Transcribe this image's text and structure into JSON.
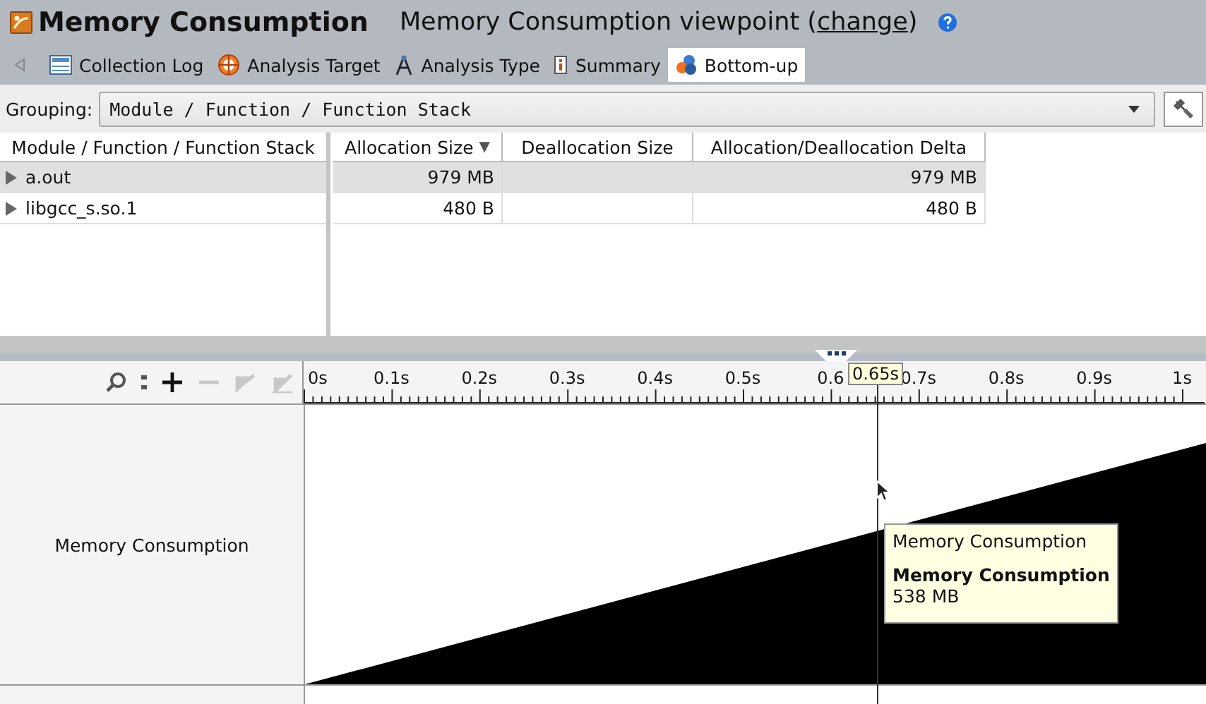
{
  "window": {
    "title": "Memory Consumption",
    "viewpoint_prefix": "Memory Consumption viewpoint (",
    "viewpoint_link": "change",
    "viewpoint_suffix": ")"
  },
  "tabs": [
    {
      "label": "Collection Log",
      "kind": "log",
      "selected": false
    },
    {
      "label": "Analysis Target",
      "kind": "target",
      "selected": false
    },
    {
      "label": "Analysis Type",
      "kind": "type",
      "selected": false
    },
    {
      "label": "Summary",
      "kind": "summary",
      "selected": false
    },
    {
      "label": "Bottom-up",
      "kind": "bottomup",
      "selected": true
    }
  ],
  "grouping": {
    "label": "Grouping:",
    "value": "Module / Function / Function Stack"
  },
  "table": {
    "tree_column": "Module / Function / Function Stack",
    "columns": [
      {
        "label": "Allocation Size",
        "sort_indicator": "▼"
      },
      {
        "label": "Deallocation Size"
      },
      {
        "label": "Allocation/Deallocation Delta"
      }
    ],
    "rows": [
      {
        "name": "a.out",
        "selected": true,
        "cells": [
          "979 MB",
          "",
          "979 MB"
        ]
      },
      {
        "name": "libgcc_s.so.1",
        "selected": false,
        "cells": [
          "480 B",
          "",
          "480 B"
        ]
      }
    ]
  },
  "timeline": {
    "tools": [
      {
        "kind": "zoom-in",
        "disabled": false
      },
      {
        "kind": "zoom-out",
        "disabled": true
      },
      {
        "kind": "undo",
        "disabled": true
      },
      {
        "kind": "reset",
        "disabled": true
      }
    ],
    "ticks": [
      "0s",
      "0.1s",
      "0.2s",
      "0.3s",
      "0.4s",
      "0.5s",
      "0.6",
      "0.7s",
      "0.8s",
      "0.9s",
      "1s"
    ],
    "marker": "0.65s",
    "track_label": "Memory Consumption",
    "tooltip": {
      "title": "Memory Consumption",
      "series": "Memory Consumption",
      "value": "538 MB"
    }
  }
}
